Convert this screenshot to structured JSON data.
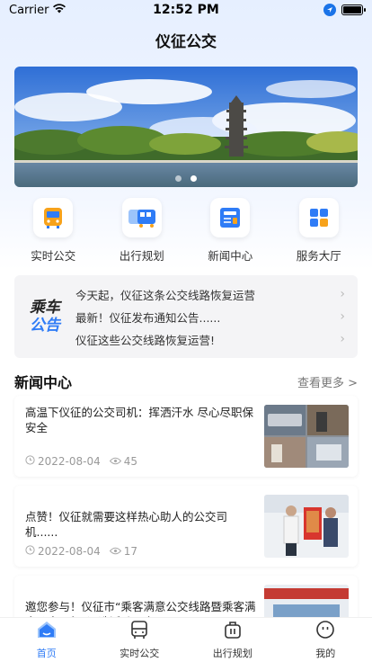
{
  "status_bar": {
    "carrier": "Carrier",
    "time": "12:52 PM"
  },
  "header": {
    "title": "仪征公交"
  },
  "banner": {
    "slides": 2,
    "active_index": 1
  },
  "quick_nav": [
    {
      "label": "实时公交",
      "icon": "bus-icon"
    },
    {
      "label": "出行规划",
      "icon": "route-icon"
    },
    {
      "label": "新闻中心",
      "icon": "news-icon"
    },
    {
      "label": "服务大厅",
      "icon": "service-grid-icon"
    }
  ],
  "notice": {
    "logo_line1": "乘车",
    "logo_line2": "公告",
    "items": [
      "今天起，仪征这条公交线路恢复运营",
      "最新！仪征发布通知公告......",
      "仪征这些公交线路恢复运营!"
    ]
  },
  "news_section": {
    "title": "新闻中心",
    "more": "查看更多 >"
  },
  "news": [
    {
      "title": "高温下仪征的公交司机：挥洒汗水 尽心尽职保安全",
      "date": "2022-08-04",
      "views": "45"
    },
    {
      "title": "点赞！仪征就需要这样热心助人的公交司机......",
      "date": "2022-08-04",
      "views": "17"
    },
    {
      "title": "邀您参与！仪征市“乘客满意公交线路暨乘客满意公交司机”评选活动开启！",
      "date": "",
      "views": ""
    }
  ],
  "tab_bar": [
    {
      "label": "首页",
      "icon": "home-icon",
      "active": true
    },
    {
      "label": "实时公交",
      "icon": "bus-icon",
      "active": false
    },
    {
      "label": "出行规划",
      "icon": "bag-icon",
      "active": false
    },
    {
      "label": "我的",
      "icon": "profile-icon",
      "active": false
    }
  ],
  "colors": {
    "accent": "#2f7cf6",
    "muted": "#999999"
  }
}
